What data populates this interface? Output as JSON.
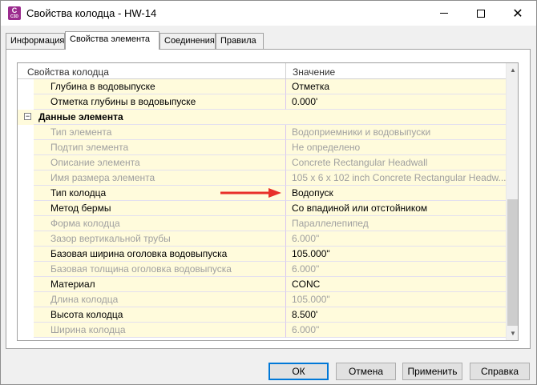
{
  "window": {
    "title": "Свойства колодца - HW-14",
    "icon_letter": "C",
    "icon_sub": "C3D",
    "controls": {
      "minimize": "minimize-icon",
      "maximize": "maximize-icon",
      "close": "✕"
    }
  },
  "tabs": [
    {
      "label": "Информация",
      "active": false
    },
    {
      "label": "Свойства элемента",
      "active": true
    },
    {
      "label": "Соединения",
      "active": false
    },
    {
      "label": "Правила",
      "active": false
    }
  ],
  "grid": {
    "headers": {
      "name": "Свойства колодца",
      "value": "Значение"
    },
    "rows": [
      {
        "name": "Глубина в водовыпуске",
        "value": "Отметка",
        "dim": false
      },
      {
        "name": "Отметка глубины в водовыпуске",
        "value": "0.000'",
        "dim": false
      },
      {
        "name": "Данные элемента",
        "value": "",
        "category": true,
        "toggle": "−"
      },
      {
        "name": "Тип элемента",
        "value": "Водоприемники и водовыпуски",
        "dim": true
      },
      {
        "name": "Подтип элемента",
        "value": "Не определено",
        "dim": true
      },
      {
        "name": "Описание элемента",
        "value": "Concrete Rectangular Headwall",
        "dim": true
      },
      {
        "name": "Имя размера элемента",
        "value": "105 x 6 x 102 inch Concrete Rectangular Headw...",
        "dim": true
      },
      {
        "name": "Тип колодца",
        "value": "Водопуск",
        "dim": false
      },
      {
        "name": "Метод бермы",
        "value": "Со впадиной или отстойником",
        "dim": false
      },
      {
        "name": "Форма колодца",
        "value": "Параллелепипед",
        "dim": true
      },
      {
        "name": "Зазор вертикальной трубы",
        "value": "6.000\"",
        "dim": true
      },
      {
        "name": "Базовая ширина оголовка водовыпуска",
        "value": "105.000\"",
        "dim": false
      },
      {
        "name": "Базовая толщина оголовка водовыпуска",
        "value": "6.000\"",
        "dim": true
      },
      {
        "name": "Материал",
        "value": "CONC",
        "dim": false
      },
      {
        "name": "Длина колодца",
        "value": "105.000\"",
        "dim": true
      },
      {
        "name": "Высота колодца",
        "value": "8.500'",
        "dim": false
      },
      {
        "name": "Ширина колодца",
        "value": "6.000\"",
        "dim": true
      }
    ]
  },
  "colors": {
    "annotation_arrow": "#e8302a",
    "row_bg": "#fffbdc",
    "ok_border": "#0078d7"
  },
  "buttons": {
    "ok": "ОК",
    "cancel": "Отмена",
    "apply": "Применить",
    "help": "Справка"
  }
}
